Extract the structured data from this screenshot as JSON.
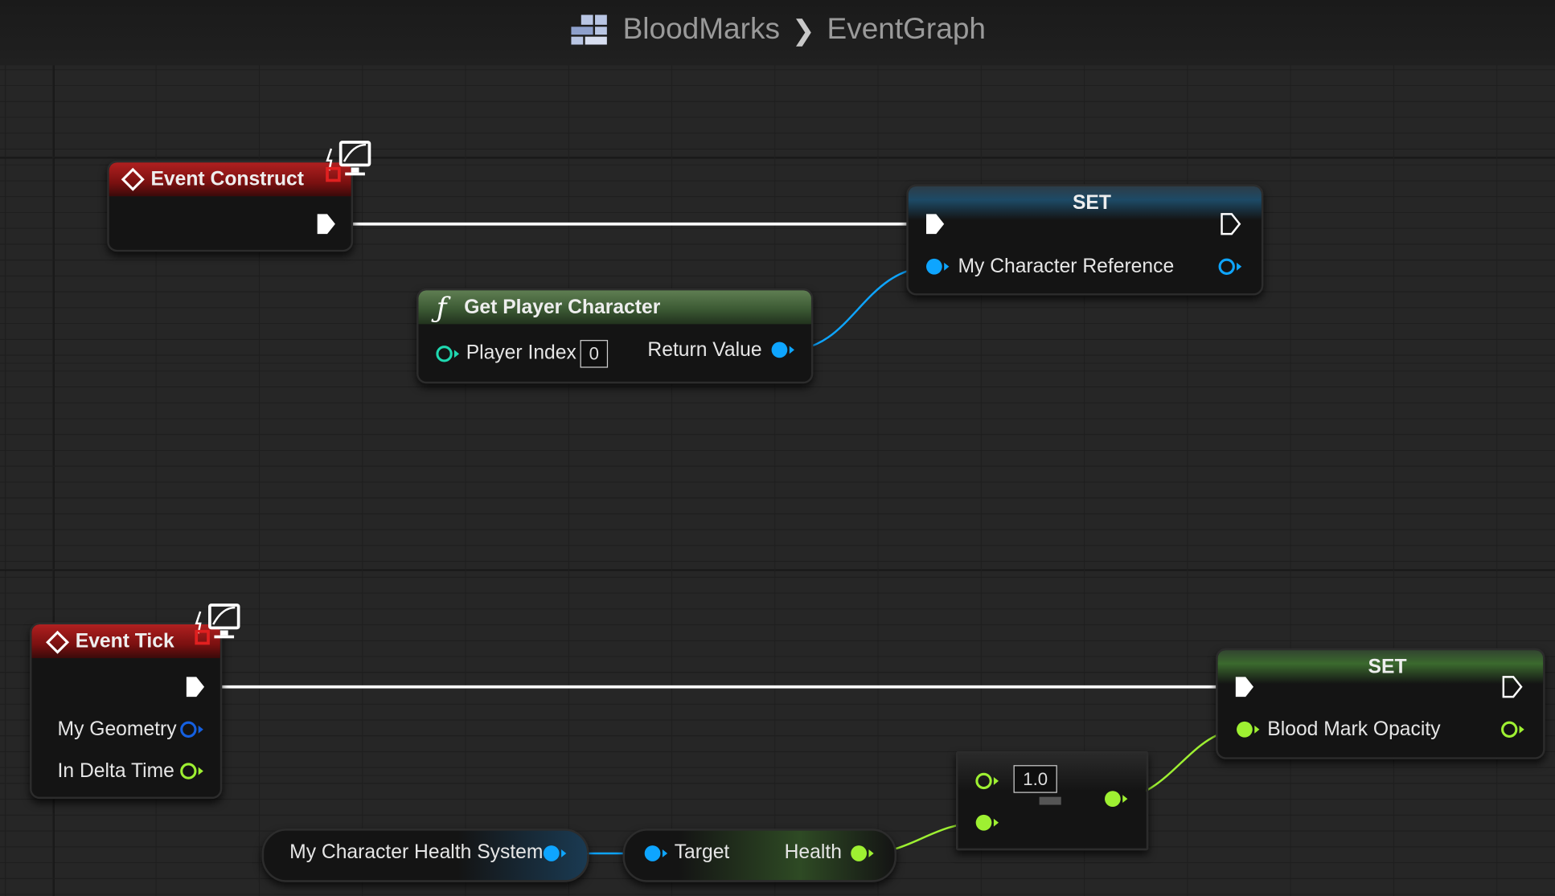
{
  "breadcrumb": {
    "asset": "BloodMarks",
    "graph": "EventGraph"
  },
  "nodes": {
    "event_construct": {
      "title": "Event Construct"
    },
    "set_character": {
      "title": "SET",
      "var": "My Character Reference"
    },
    "get_player_character": {
      "title": "Get Player Character",
      "input": "Player Index",
      "input_value": "0",
      "output": "Return Value"
    },
    "event_tick": {
      "title": "Event Tick",
      "out1": "My Geometry",
      "out2": "In Delta Time"
    },
    "set_opacity": {
      "title": "SET",
      "var": "Blood Mark Opacity"
    },
    "divide": {
      "value": "1.0"
    },
    "health_system": {
      "label": "My Character Health System"
    },
    "get_health": {
      "input": "Target",
      "output": "Health"
    }
  },
  "colors": {
    "exec": "#ffffff",
    "object": "#0ea5ff",
    "float": "#9ef032",
    "int": "#1fd8b0",
    "event_header": "#b02020",
    "function_header": "#4f6e45"
  },
  "icons": [
    "blueprint-icon",
    "event-diamond-icon",
    "function-icon",
    "replicate-monitor-icon"
  ]
}
